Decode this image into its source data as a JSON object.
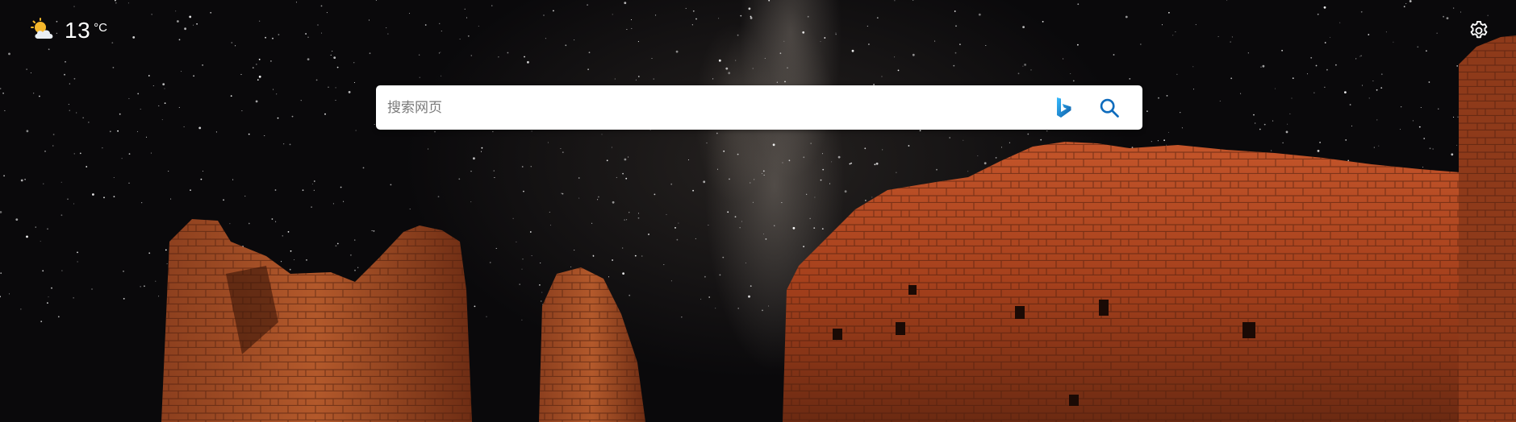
{
  "weather": {
    "temperature": "13",
    "unit": "°C",
    "icon": "partly-cloudy-icon"
  },
  "search": {
    "placeholder": "搜索网页",
    "value": "",
    "logo": "bing-logo-icon",
    "button_icon": "search-icon"
  },
  "settings": {
    "icon": "gear-icon"
  },
  "colors": {
    "bing_blue": "#1a73c7",
    "search_icon": "#0f6cbd",
    "sun": "#f5b72b",
    "ruin_red": "#b24a22"
  }
}
